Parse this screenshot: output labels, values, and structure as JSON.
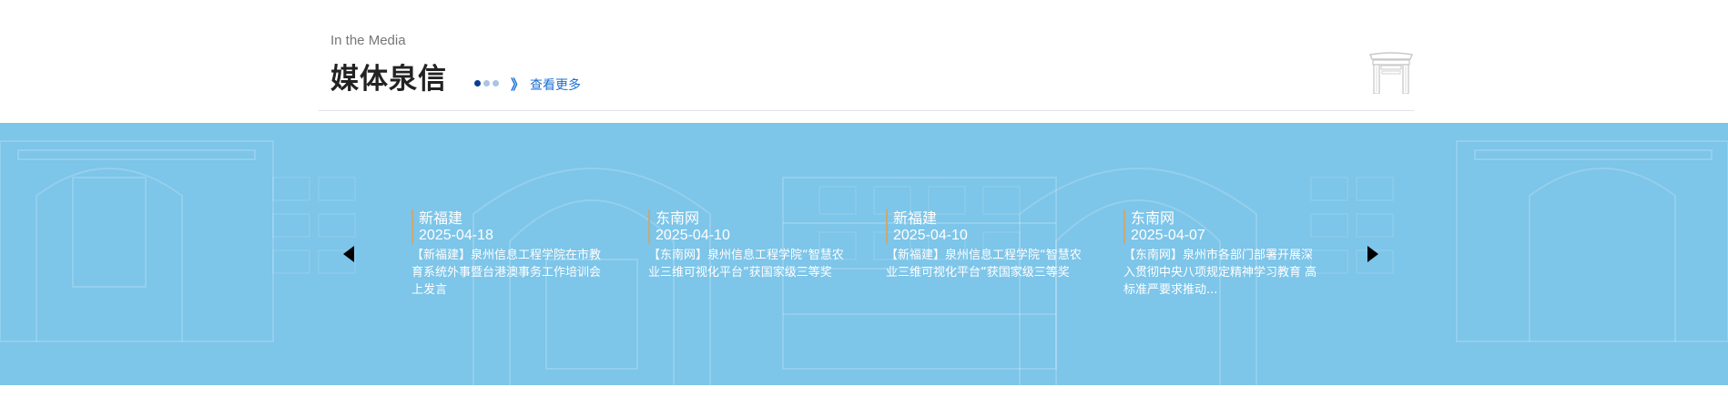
{
  "header": {
    "subtitle": "In the Media",
    "title": "媒体泉信",
    "more_label": "查看更多",
    "more_chevron": "》"
  },
  "colors": {
    "band_bg": "#7dc5e9",
    "accent_link": "#1a6fd3",
    "card_border": "#c8a978"
  },
  "carousel": {
    "items": [
      {
        "source": "新福建",
        "date": "2025-04-18",
        "desc": "【新福建】泉州信息工程学院在市教育系统外事暨台港澳事务工作培训会上发言"
      },
      {
        "source": "东南网",
        "date": "2025-04-10",
        "desc": "【东南网】泉州信息工程学院“智慧农业三维可视化平台”获国家级三等奖"
      },
      {
        "source": "新福建",
        "date": "2025-04-10",
        "desc": "【新福建】泉州信息工程学院“智慧农业三维可视化平台”获国家级三等奖"
      },
      {
        "source": "东南网",
        "date": "2025-04-07",
        "desc": "【东南网】泉州市各部门部署开展深入贯彻中央八项规定精神学习教育 高标准严要求推动..."
      }
    ]
  }
}
